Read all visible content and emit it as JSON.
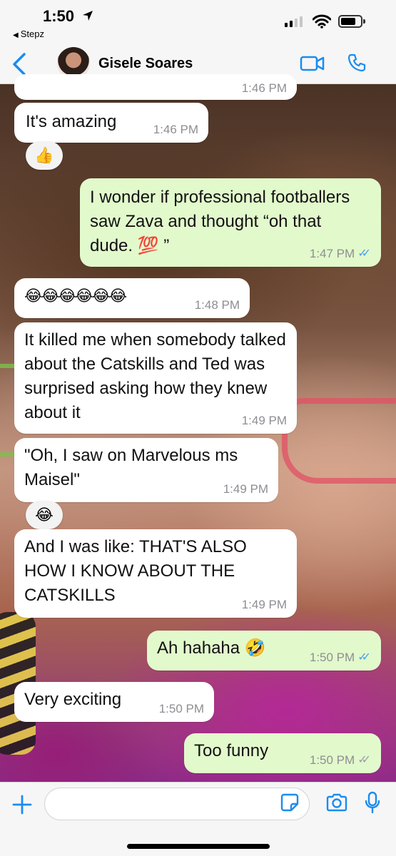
{
  "status_bar": {
    "time": "1:50",
    "back_app": "Stepz"
  },
  "header": {
    "contact_name": "Gisele Soares",
    "icons": [
      "chevron-left-icon",
      "avatar",
      "video-camera-icon",
      "phone-icon"
    ]
  },
  "colors": {
    "accent": "#1a8cf0",
    "incoming_bubble": "#ffffff",
    "outgoing_bubble": "#e2f9cc",
    "read_ticks": "#4aa3e8"
  },
  "messages": [
    {
      "direction": "in",
      "text": "",
      "time": "1:46 PM"
    },
    {
      "direction": "in",
      "text": "It's amazing",
      "time": "1:46 PM",
      "reaction": "👍"
    },
    {
      "direction": "out",
      "text": "I wonder if professional footballers saw Zava and thought “oh that dude. 💯 ”",
      "time": "1:47 PM",
      "status": "read"
    },
    {
      "direction": "in",
      "text": "😂😂😂😂😂😂",
      "time": "1:48 PM"
    },
    {
      "direction": "in",
      "text": "It killed me when somebody talked about the Catskills and Ted was surprised asking how they knew about it",
      "time": "1:49 PM"
    },
    {
      "direction": "in",
      "text": "\"Oh, I saw on Marvelous ms Maisel\"",
      "time": "1:49 PM",
      "reaction": "😂"
    },
    {
      "direction": "in",
      "text": "And I was like: THAT'S ALSO HOW I KNOW ABOUT THE CATSKILLS",
      "time": "1:49 PM"
    },
    {
      "direction": "out",
      "text": "Ah hahaha 🤣",
      "time": "1:50 PM",
      "status": "read"
    },
    {
      "direction": "in",
      "text": "Very exciting",
      "time": "1:50 PM"
    },
    {
      "direction": "out",
      "text": "Too funny",
      "time": "1:50 PM",
      "status": "sent"
    }
  ],
  "input_bar": {
    "placeholder": "",
    "icons": [
      "plus-icon",
      "sticker-icon",
      "camera-icon",
      "microphone-icon"
    ]
  }
}
